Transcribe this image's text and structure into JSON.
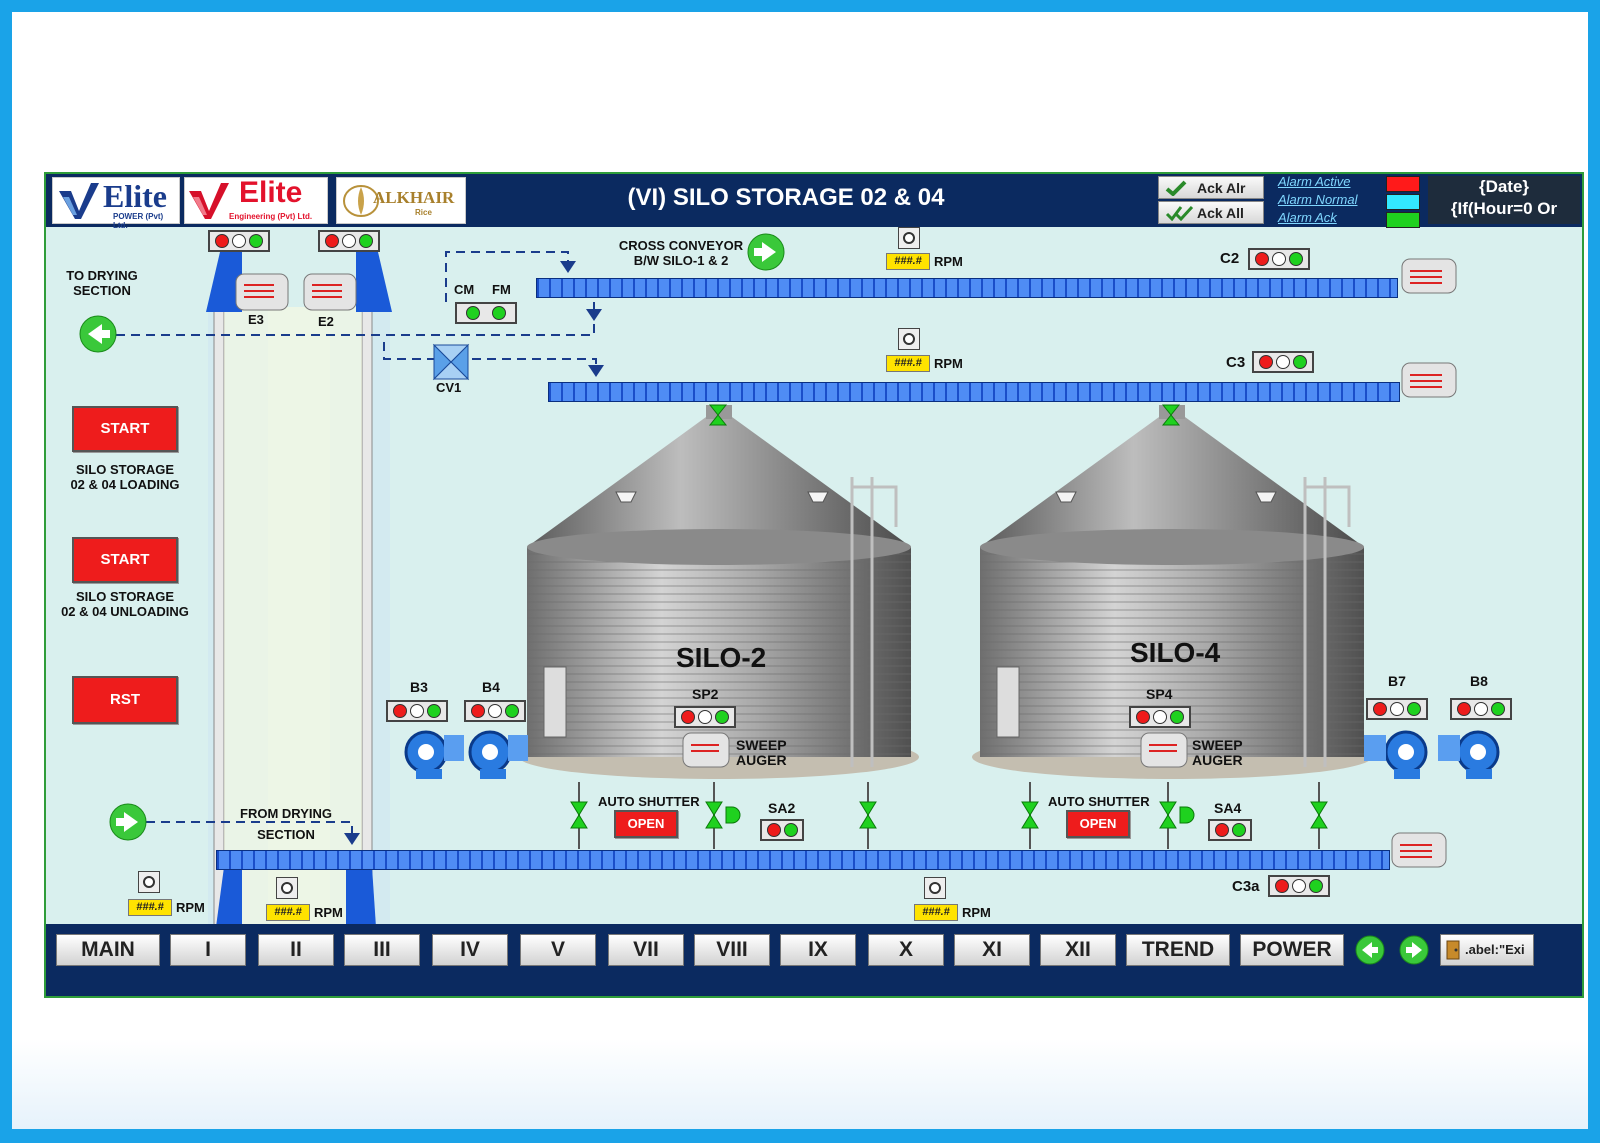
{
  "header": {
    "title": "(VI) SILO STORAGE 02 & 04",
    "logos": {
      "elite_power": {
        "word": "Elite",
        "sub": "POWER (Pvt) Ltd."
      },
      "elite_engineering": {
        "word": "Elite",
        "sub": "Engineering (Pvt) Ltd."
      },
      "alkhair": {
        "word": "ALKHAIR",
        "sub": "Rice"
      }
    },
    "ack_alr_label": "Ack Alr",
    "ack_all_label": "Ack All",
    "alarm_legend": [
      {
        "label": "Alarm Active",
        "color": "#ff1a1a"
      },
      {
        "label": "Alarm Normal",
        "color": "#33e8ff"
      },
      {
        "label": "Alarm Ack",
        "color": "#1fd11f"
      }
    ],
    "date_line1": "{Date}",
    "date_line2": "{If(Hour=0 Or"
  },
  "labels": {
    "to_drying_1": "TO DRYING",
    "to_drying_2": "SECTION",
    "from_drying_1": "FROM DRYING",
    "from_drying_2": "SECTION",
    "cross_conveyor_1": "CROSS CONVEYOR",
    "cross_conveyor_2": "B/W SILO-1 & 2",
    "cm": "CM",
    "fm": "FM",
    "cv1": "CV1",
    "e3": "E3",
    "e2": "E2",
    "c2": "C2",
    "c3": "C3",
    "c3a": "C3a",
    "b3": "B3",
    "b4": "B4",
    "b7": "B7",
    "b8": "B8",
    "sp2": "SP2",
    "sp4": "SP4",
    "sa2": "SA2",
    "sa4": "SA4",
    "sweep_1": "SWEEP",
    "sweep_2": "AUGER",
    "auto_shutter": "AUTO SHUTTER",
    "rpm_value": "###.#",
    "rpm_unit": "RPM"
  },
  "silos": {
    "silo2": "SILO-2",
    "silo4": "SILO-4"
  },
  "controls": {
    "start_label": "START",
    "loading_1": "SILO STORAGE",
    "loading_2": "02 & 04 LOADING",
    "unloading_1": "SILO STORAGE",
    "unloading_2": "02 & 04 UNLOADING",
    "rst_label": "RST",
    "open_label": "OPEN"
  },
  "nav": {
    "buttons": [
      "MAIN",
      "I",
      "II",
      "III",
      "IV",
      "V",
      "VII",
      "VIII",
      "IX",
      "X",
      "XI",
      "XII",
      "TREND",
      "POWER"
    ],
    "exit_label": ".abel:\"Exi"
  },
  "colors": {
    "header_bg": "#0b2a60",
    "panel_bg": "#d9f0ee",
    "conveyor": "#3a78e8",
    "lamp_red": "#ee1b1b",
    "lamp_green": "#1fd11f",
    "rpm_box": "#ffe300"
  }
}
